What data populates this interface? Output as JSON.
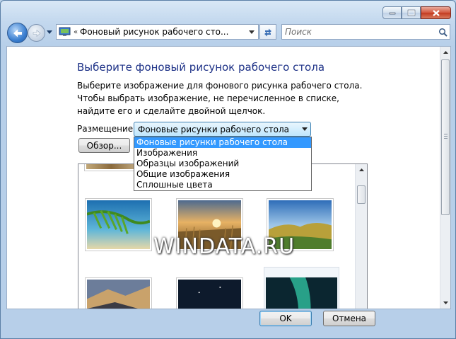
{
  "address": {
    "crumb": "Фоновый рисунок рабочего сто..."
  },
  "search": {
    "placeholder": "Поиск"
  },
  "main": {
    "title": "Выберите фоновый рисунок рабочего стола",
    "instructions": "Выберите изображение для фонового рисунка рабочего стола. Чтобы выбрать изображение, не перечисленное в списке, найдите его и сделайте двойной щелчок.",
    "placement_label": "Размещение",
    "placement_value": "Фоновые рисунки рабочего стола",
    "placement_options": [
      "Фоновые рисунки рабочего стола",
      "Изображения",
      "Образцы изображений",
      "Общие изображения",
      "Сплошные цвета"
    ],
    "browse_label": "Обзор..."
  },
  "watermark": "WINDATA.RU",
  "footer": {
    "ok_label": "OK",
    "cancel_label": "Отмена"
  },
  "colors": {
    "title_text": "#1e3287",
    "selection": "#3399ff"
  }
}
